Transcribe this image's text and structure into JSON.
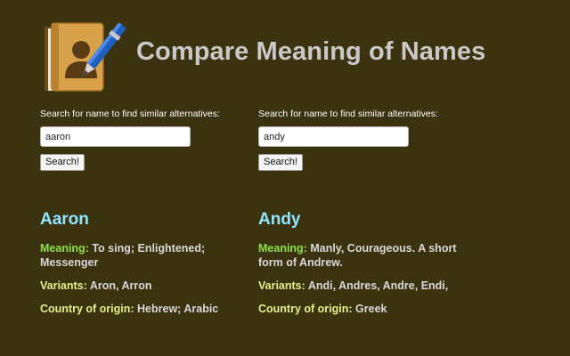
{
  "header": {
    "title": "Compare Meaning of Names",
    "icon": "address-book-pen-icon"
  },
  "search_left": {
    "label": "Search for name to find similar alternatives:",
    "value": "aaron",
    "button": "Search!"
  },
  "search_right": {
    "label": "Search for name to find similar alternatives:",
    "value": "andy",
    "button": "Search!"
  },
  "labels": {
    "meaning": "Meaning:",
    "variants": "Variants:",
    "origin": "Country of origin:"
  },
  "result_left": {
    "name": "Aaron",
    "meaning": "To sing; Enlightened; Messenger",
    "variants": "Aron, Arron",
    "origin": "Hebrew; Arabic"
  },
  "result_right": {
    "name": "Andy",
    "meaning": "Manly, Courageous. A short form of Andrew.",
    "variants": "Andi, Andres, Andre, Endi,",
    "origin": "Greek"
  },
  "colors": {
    "background": "#3b320f",
    "name_heading": "#8fe6ff",
    "meaning_label": "#8ce04a",
    "other_label": "#e6f08a",
    "body_text": "#d8d8d8"
  }
}
